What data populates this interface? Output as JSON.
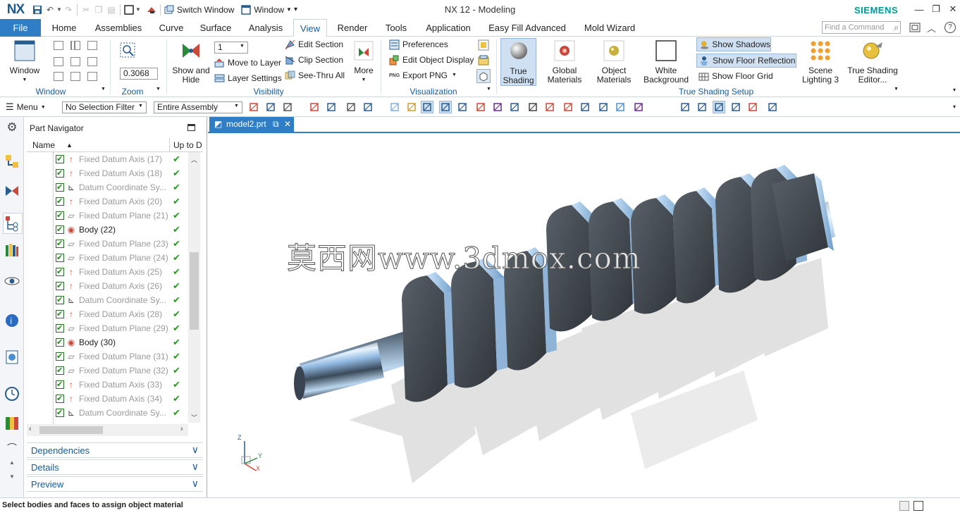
{
  "app": {
    "logo": "NX",
    "title": "NX 12 - Modeling",
    "brand": "SIEMENS",
    "switch_window": "Switch Window",
    "window_menu": "Window"
  },
  "tabs": [
    "File",
    "Home",
    "Assemblies",
    "Curve",
    "Surface",
    "Analysis",
    "View",
    "Render",
    "Tools",
    "Application",
    "Easy Fill Advanced",
    "Mold Wizard"
  ],
  "active_tab": "View",
  "find_command": {
    "placeholder": "Find a Command"
  },
  "ribbon": {
    "window_group": {
      "button": "Window",
      "label": "Window"
    },
    "zoom_group": {
      "value": "0.3068",
      "label": "Zoom"
    },
    "visibility_group": {
      "show_hide": "Show and Hide",
      "layer_value": "1",
      "move_to_layer": "Move to Layer",
      "layer_settings": "Layer Settings",
      "edit_section": "Edit Section",
      "clip_section": "Clip Section",
      "see_thru_all": "See-Thru All",
      "more": "More",
      "label": "Visibility"
    },
    "visualization_group": {
      "preferences": "Preferences",
      "edit_object_display": "Edit Object Display",
      "png_tag": "PNG",
      "export_png": "Export PNG",
      "label": "Visualization"
    },
    "true_shading_group": {
      "true_shading": "True Shading",
      "global_materials": "Global Materials",
      "object_materials": "Object Materials",
      "white_background": "White Background",
      "show_shadows": "Show Shadows",
      "show_floor_reflection": "Show Floor Reflection",
      "show_floor_grid": "Show Floor Grid",
      "scene_lighting": "Scene Lighting 3",
      "true_shading_editor": "True Shading Editor...",
      "label": "True Shading Setup"
    }
  },
  "selection_bar": {
    "menu": "Menu",
    "filter": "No Selection Filter",
    "scope": "Entire Assembly"
  },
  "part_navigator": {
    "title": "Part Navigator",
    "col_name": "Name",
    "col_uptodate": "Up to D",
    "rows": [
      {
        "label": "Fixed Datum Axis (17)",
        "kind": "axis"
      },
      {
        "label": "Fixed Datum Axis (18)",
        "kind": "axis"
      },
      {
        "label": "Datum Coordinate Sy...",
        "kind": "csys"
      },
      {
        "label": "Fixed Datum Axis (20)",
        "kind": "axis"
      },
      {
        "label": "Fixed Datum Plane (21)",
        "kind": "plane"
      },
      {
        "label": "Body (22)",
        "kind": "body"
      },
      {
        "label": "Fixed Datum Plane (23)",
        "kind": "plane"
      },
      {
        "label": "Fixed Datum Plane (24)",
        "kind": "plane"
      },
      {
        "label": "Fixed Datum Axis (25)",
        "kind": "axis"
      },
      {
        "label": "Fixed Datum Axis (26)",
        "kind": "axis"
      },
      {
        "label": "Datum Coordinate Sy...",
        "kind": "csys"
      },
      {
        "label": "Fixed Datum Axis (28)",
        "kind": "axis"
      },
      {
        "label": "Fixed Datum Plane (29)",
        "kind": "plane"
      },
      {
        "label": "Body (30)",
        "kind": "body"
      },
      {
        "label": "Fixed Datum Plane (31)",
        "kind": "plane"
      },
      {
        "label": "Fixed Datum Plane (32)",
        "kind": "plane"
      },
      {
        "label": "Fixed Datum Axis (33)",
        "kind": "axis"
      },
      {
        "label": "Fixed Datum Axis (34)",
        "kind": "axis"
      },
      {
        "label": "Datum Coordinate Sy...",
        "kind": "csys"
      }
    ],
    "sections": [
      "Dependencies",
      "Details",
      "Preview"
    ]
  },
  "graphics": {
    "tab": "model2.prt",
    "watermark": "莫西网www.3dmox.com",
    "triad": {
      "z": "Z",
      "y": "Y",
      "x": "X"
    }
  },
  "status": {
    "text": "Select bodies and faces to assign object material"
  },
  "colors": {
    "accent": "#2f7dc4",
    "tab_text": "#1a5a99",
    "check_green": "#1ea01e",
    "brand": "#009999"
  }
}
